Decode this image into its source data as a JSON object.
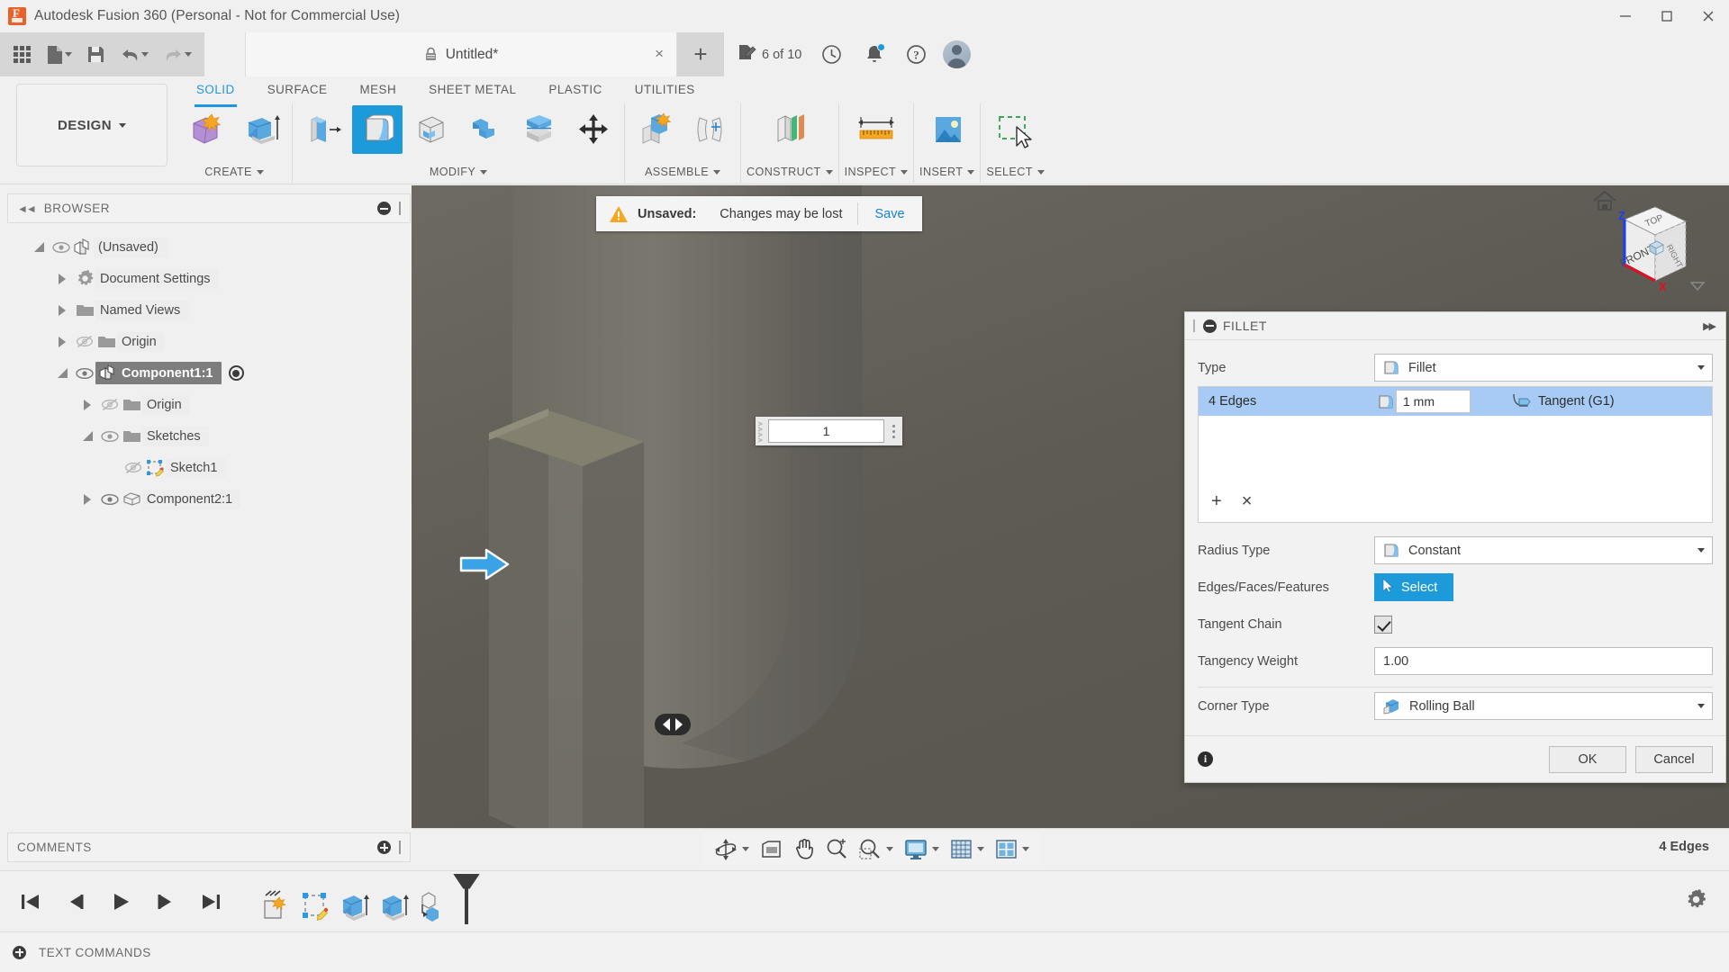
{
  "window": {
    "title": "Autodesk Fusion 360 (Personal - Not for Commercial Use)",
    "logo_icon": "fusion-logo-icon",
    "minimize_icon": "minimize-icon",
    "maximize_icon": "maximize-icon",
    "close_icon": "close-icon"
  },
  "quick_access": {
    "grid_icon": "app-grid-icon",
    "new_icon": "new-document-icon",
    "save_icon": "save-icon",
    "undo_icon": "undo-icon",
    "redo_icon": "redo-icon"
  },
  "document_tab": {
    "lock_icon": "lock-icon",
    "name": "Untitled*",
    "close_label": "×",
    "new_tab_label": "+"
  },
  "tab_right": {
    "edit_count_icon": "edit-document-icon",
    "edit_count": "6 of 10",
    "history_icon": "clock-icon",
    "notifications_icon": "bell-icon",
    "help_icon": "help-icon",
    "avatar_icon": "avatar-icon"
  },
  "workspace": {
    "label": "DESIGN"
  },
  "ribbon": {
    "tabs": [
      {
        "label": "SOLID",
        "active": true
      },
      {
        "label": "SURFACE",
        "active": false
      },
      {
        "label": "MESH",
        "active": false
      },
      {
        "label": "SHEET METAL",
        "active": false
      },
      {
        "label": "PLASTIC",
        "active": false
      },
      {
        "label": "UTILITIES",
        "active": false
      }
    ],
    "groups": [
      {
        "label": "CREATE",
        "has_caret": true
      },
      {
        "label": "MODIFY",
        "has_caret": true
      },
      {
        "label": "ASSEMBLE",
        "has_caret": true
      },
      {
        "label": "CONSTRUCT",
        "has_caret": true
      },
      {
        "label": "INSPECT",
        "has_caret": true
      },
      {
        "label": "INSERT",
        "has_caret": true
      },
      {
        "label": "SELECT",
        "has_caret": true
      }
    ],
    "active_tool": "fillet-tool"
  },
  "browser": {
    "title": "BROWSER",
    "collapse_icon": "collapse-left-icon",
    "minimize_icon": "minimize-panel-icon",
    "items": [
      {
        "label": "(Unsaved)",
        "indent": 0,
        "expanded": true,
        "visible": true,
        "icon": "component-icon",
        "selected": false
      },
      {
        "label": "Document Settings",
        "indent": 1,
        "expanded": false,
        "visible": null,
        "icon": "gear-icon",
        "selected": false
      },
      {
        "label": "Named Views",
        "indent": 1,
        "expanded": false,
        "visible": null,
        "icon": "folder-icon",
        "selected": false
      },
      {
        "label": "Origin",
        "indent": 1,
        "expanded": false,
        "visible": false,
        "icon": "folder-icon",
        "selected": false
      },
      {
        "label": "Component1:1",
        "indent": 1,
        "expanded": true,
        "visible": true,
        "icon": "component-icon",
        "selected": true,
        "activated": true
      },
      {
        "label": "Origin",
        "indent": 2,
        "expanded": false,
        "visible": false,
        "icon": "folder-icon",
        "selected": false
      },
      {
        "label": "Sketches",
        "indent": 2,
        "expanded": true,
        "visible": true,
        "icon": "folder-icon",
        "selected": false
      },
      {
        "label": "Sketch1",
        "indent": 3,
        "expanded": null,
        "visible": false,
        "icon": "sketch-icon",
        "selected": false
      },
      {
        "label": "Component2:1",
        "indent": 2,
        "expanded": false,
        "visible": true,
        "icon": "body-icon",
        "selected": false
      }
    ]
  },
  "comments": {
    "title": "COMMENTS",
    "add_icon": "add-comment-icon"
  },
  "canvas": {
    "unsaved_banner": {
      "warning_icon": "warning-icon",
      "label": "Unsaved:",
      "message": "Changes may be lost",
      "action": "Save"
    },
    "dimension_edit": {
      "value": "1",
      "grip_icon": "drag-grip-icon",
      "menu_icon": "more-options-icon"
    },
    "manipulator_arrow_icon": "blue-arrow-handle-icon",
    "manipulator_slider_icon": "double-arrow-handle-icon",
    "viewcube": {
      "front_label": "FRONT",
      "top_label": "TOP",
      "right_label": "RIGHT",
      "home_icon": "home-icon",
      "axis_z": "Z",
      "axis_x": "X",
      "z_color": "#1f3df0",
      "x_color": "#e01020",
      "dropdown_icon": "viewcube-dropdown-icon"
    },
    "model_color": "#6f6c64",
    "background_color": "#5e5b54"
  },
  "fillet_dialog": {
    "title": "FILLET",
    "minimize_icon": "minimize-dialog-icon",
    "expand_icon": "expand-dialog-icon",
    "type_label": "Type",
    "type_value": "Fillet",
    "type_icon": "fillet-icon",
    "edges": [
      {
        "name": "4 Edges",
        "radius_icon": "fillet-icon",
        "radius_value": "1 mm",
        "continuity_icon": "tangent-icon",
        "continuity": "Tangent (G1)",
        "selected": true
      }
    ],
    "list_add_label": "+",
    "list_remove_label": "×",
    "radius_type_label": "Radius Type",
    "radius_type_value": "Constant",
    "radius_type_icon": "fillet-icon",
    "selection_label": "Edges/Faces/Features",
    "select_button": "Select",
    "select_cursor_icon": "cursor-icon",
    "tangent_chain_label": "Tangent Chain",
    "tangent_chain_checked": true,
    "tangency_weight_label": "Tangency Weight",
    "tangency_weight_value": "1.00",
    "corner_type_label": "Corner Type",
    "corner_type_value": "Rolling Ball",
    "corner_type_icon": "rolling-ball-icon",
    "info_icon": "info-icon",
    "ok_label": "OK",
    "cancel_label": "Cancel",
    "accent_color": "#1d9ada",
    "selected_row_color": "#a7cbf5"
  },
  "navbar": {
    "buttons": [
      {
        "icon": "orbit-icon",
        "caret": true
      },
      {
        "icon": "look-at-icon",
        "caret": false
      },
      {
        "icon": "pan-icon",
        "caret": false
      },
      {
        "icon": "zoom-icon",
        "caret": false
      },
      {
        "icon": "zoom-window-icon",
        "caret": true
      },
      {
        "icon": "display-settings-icon",
        "caret": true
      },
      {
        "icon": "grid-snaps-icon",
        "caret": true
      },
      {
        "icon": "viewports-icon",
        "caret": true
      }
    ]
  },
  "status_bar": {
    "selection_info": "4 Edges"
  },
  "timeline": {
    "playback": [
      {
        "icon": "skip-to-start-icon"
      },
      {
        "icon": "step-back-icon"
      },
      {
        "icon": "play-icon"
      },
      {
        "icon": "step-forward-icon"
      },
      {
        "icon": "skip-to-end-icon"
      }
    ],
    "features": [
      {
        "icon": "fillet-feature-icon"
      },
      {
        "icon": "sketch-feature-icon"
      },
      {
        "icon": "extrude-feature-icon"
      },
      {
        "icon": "extrude-feature-icon"
      },
      {
        "icon": "new-component-feature-icon"
      }
    ],
    "marker_icon": "timeline-marker-icon",
    "settings_icon": "gear-icon"
  },
  "text_commands": {
    "expand_icon": "expand-icon",
    "label": "TEXT COMMANDS"
  }
}
